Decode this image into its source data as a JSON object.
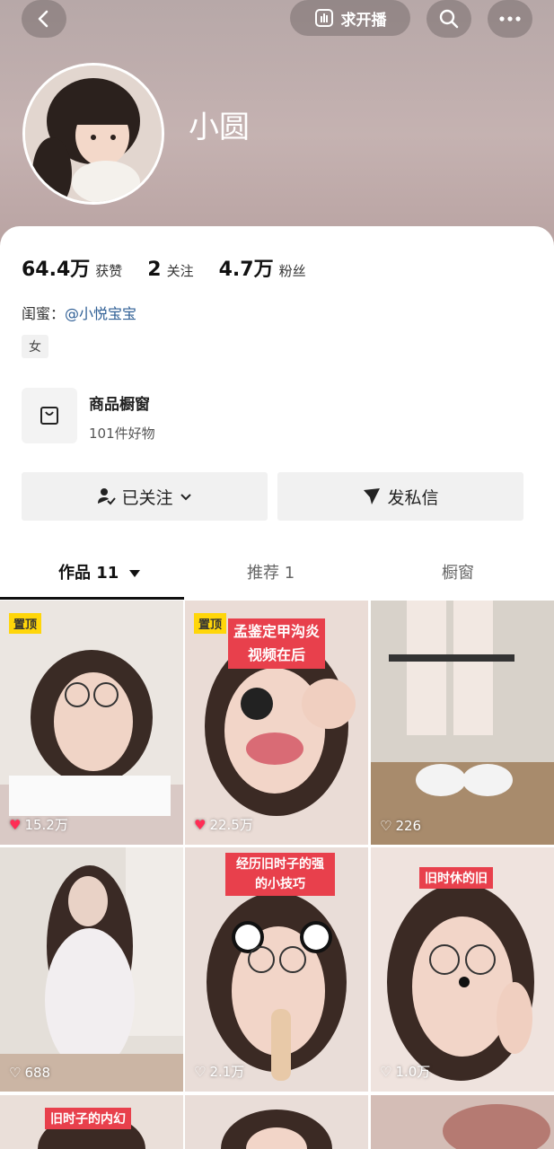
{
  "header": {
    "live_button_label": "求开播"
  },
  "profile": {
    "name": "小圆"
  },
  "stats": [
    {
      "value": "64.4万",
      "label": "获赞"
    },
    {
      "value": "2",
      "label": "关注"
    },
    {
      "value": "4.7万",
      "label": "粉丝"
    }
  ],
  "bestie": {
    "prefix": "闺蜜：",
    "link": "@小悦宝宝"
  },
  "gender": "女",
  "shop": {
    "title": "商品橱窗",
    "subtitle": "101件好物"
  },
  "actions": {
    "follow_label": "已关注",
    "message_label": "发私信"
  },
  "tabs": [
    {
      "label": "作品 11"
    },
    {
      "label": "推荐 1"
    },
    {
      "label": "橱窗"
    }
  ],
  "videos": [
    {
      "badge": "置顶",
      "likes": "15.2万"
    },
    {
      "badge": "置顶",
      "overlay": "孟鉴定甲沟炎\n视频在后",
      "likes": "22.5万"
    },
    {
      "likes": "226"
    },
    {
      "likes": "688"
    },
    {
      "overlay": "经历旧时子的强的小技巧",
      "likes": "2.1万"
    },
    {
      "overlay": "旧时休的旧",
      "likes": "1.0万"
    },
    {
      "overlay": "旧时子的内幻"
    },
    {},
    {}
  ],
  "colors": {
    "header_bg": "#c0adac",
    "link": "#2f5f95",
    "badge": "#ffd60a",
    "overlay_red": "#e8404c"
  }
}
